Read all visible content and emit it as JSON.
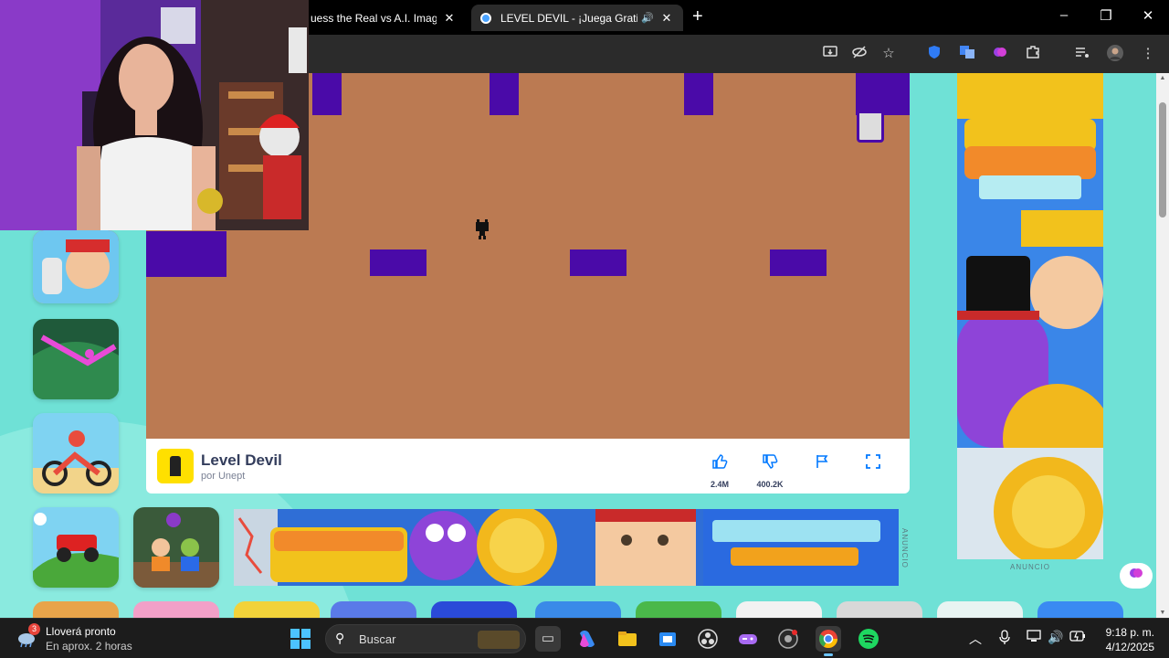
{
  "browser": {
    "tabs": [
      {
        "title": "uess the Real vs A.I. Image",
        "active": false
      },
      {
        "title": "LEVEL DEVIL - ¡Juega Gratis",
        "active": true
      }
    ],
    "new_tab": "+",
    "window_controls": {
      "minimize": "–",
      "maximize": "❐",
      "close": "✕"
    },
    "toolbar_icons": [
      "install-app-icon",
      "eye-off-icon",
      "star-icon",
      "shield-extension-icon",
      "translate-extension-icon",
      "brain-extension-icon",
      "puzzle-icon",
      "media-icon",
      "profile-avatar",
      "menu-dots-icon"
    ]
  },
  "game": {
    "name": "Level Devil",
    "author": "por Unept",
    "likes": "2.4M",
    "dislikes": "400.2K",
    "colors": {
      "background": "#bb7a52",
      "blocks": "#4a0aa8",
      "door": "#dddddd"
    }
  },
  "ads": {
    "banner_label": "ANUNCIO",
    "side_label": "ANUNCIO"
  },
  "taskbar": {
    "weather_title": "Lloverá pronto",
    "weather_sub": "En aprox. 2 horas",
    "weather_badge": "3",
    "search_placeholder": "Buscar",
    "time": "9:18 p. m.",
    "date": "4/12/2025"
  }
}
